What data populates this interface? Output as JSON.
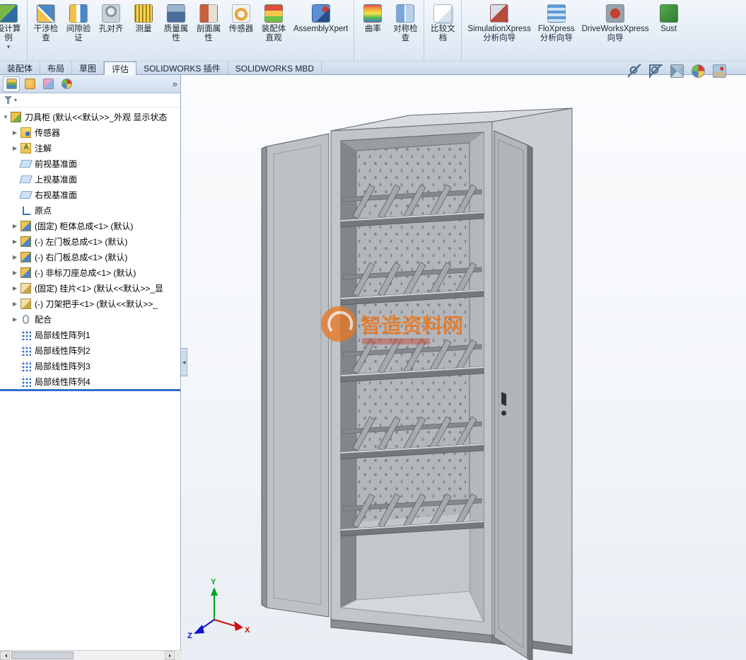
{
  "ribbon": {
    "groups": [
      {
        "items": [
          {
            "label": "设计算\n例",
            "icon": "design-study",
            "has_arrow": true
          }
        ]
      },
      {
        "items": [
          {
            "label": "干涉检\n查",
            "icon": "interference-detection"
          },
          {
            "label": "间隙验\n证",
            "icon": "clearance-verification"
          },
          {
            "label": "孔对齐",
            "icon": "hole-alignment"
          },
          {
            "label": "测量",
            "icon": "measure"
          },
          {
            "label": "质量属\n性",
            "icon": "mass-properties"
          },
          {
            "label": "剖面属\n性",
            "icon": "section-properties"
          },
          {
            "label": "传感器",
            "icon": "sensor"
          },
          {
            "label": "装配体\n直观",
            "icon": "assembly-visualization"
          },
          {
            "label": "AssemblyXpert",
            "icon": "assembly-xpert"
          }
        ]
      },
      {
        "items": [
          {
            "label": "曲率",
            "icon": "curvature"
          },
          {
            "label": "对称检\n查",
            "icon": "symmetry-check"
          }
        ]
      },
      {
        "items": [
          {
            "label": "比较文\n档",
            "icon": "compare-documents"
          }
        ]
      },
      {
        "items": [
          {
            "label": "SimulationXpress\n分析向导",
            "icon": "simulationxpress"
          },
          {
            "label": "FloXpress\n分析向导",
            "icon": "floxpress"
          },
          {
            "label": "DriveWorksXpress\n向导",
            "icon": "driveworksxpress"
          },
          {
            "label": "Sust",
            "icon": "sustainability"
          }
        ]
      }
    ]
  },
  "tabs": {
    "items": [
      {
        "name": "assembly",
        "label": "装配体"
      },
      {
        "name": "layout",
        "label": "布局"
      },
      {
        "name": "sketch",
        "label": "草图"
      },
      {
        "name": "evaluate",
        "label": "评估",
        "active": true
      },
      {
        "name": "solidworks-addins",
        "label": "SOLIDWORKS 插件"
      },
      {
        "name": "solidworks-mbd",
        "label": "SOLIDWORKS MBD"
      }
    ]
  },
  "panel": {
    "overflow_label": "»",
    "tabs": [
      {
        "name": "featuremanager"
      },
      {
        "name": "propertymanager"
      },
      {
        "name": "configurationmanager"
      },
      {
        "name": "displaymanager"
      }
    ]
  },
  "feature_tree": {
    "items": [
      {
        "label": "刀具柜 (默认<<默认>>_外观 显示状态",
        "icon": "assembly",
        "expanded": true
      },
      {
        "label": "传感器",
        "icon": "sensors-folder",
        "collapsed": true
      },
      {
        "label": "注解",
        "icon": "annotations-folder",
        "collapsed": true
      },
      {
        "label": "前视基准面",
        "icon": "plane"
      },
      {
        "label": "上视基准面",
        "icon": "plane"
      },
      {
        "label": "右视基准面",
        "icon": "plane"
      },
      {
        "label": "原点",
        "icon": "origin"
      },
      {
        "label": "(固定) 柜体总成<1> (默认)",
        "icon": "subassembly",
        "collapsed": true
      },
      {
        "label": "(-) 左门板总成<1> (默认)",
        "icon": "subassembly",
        "collapsed": true
      },
      {
        "label": "(-) 右门板总成<1> (默认)",
        "icon": "subassembly",
        "collapsed": true
      },
      {
        "label": "(-) 非标刀座总成<1> (默认)",
        "icon": "subassembly",
        "collapsed": true
      },
      {
        "label": "(固定) 挂片<1> (默认<<默认>>_显",
        "icon": "part",
        "collapsed": true
      },
      {
        "label": "(-) 刀架把手<1> (默认<<默认>>_",
        "icon": "part",
        "collapsed": true
      },
      {
        "label": "配合",
        "icon": "mates-folder",
        "collapsed": true
      },
      {
        "label": "局部线性阵列1",
        "icon": "linear-pattern"
      },
      {
        "label": "局部线性阵列2",
        "icon": "linear-pattern"
      },
      {
        "label": "局部线性阵列3",
        "icon": "linear-pattern"
      },
      {
        "label": "局部线性阵列4",
        "icon": "linear-pattern"
      }
    ]
  },
  "viewport": {
    "heads_up": {
      "icons": [
        {
          "name": "zoom-fit"
        },
        {
          "name": "zoom-area"
        },
        {
          "name": "view-orientation"
        },
        {
          "name": "edit-appearance"
        },
        {
          "name": "apply-scene"
        }
      ]
    },
    "watermark": {
      "text": "智造资料网"
    },
    "triad": {
      "x_label": "X",
      "y_label": "Y",
      "z_label": "Z"
    }
  },
  "colors": {
    "watermark_orange": "#e87720",
    "watermark_red": "#c43b2a",
    "rollback_blue": "#2f6fd0",
    "triad_x": "#cc1111",
    "triad_y": "#00a020",
    "triad_z": "#1111cc",
    "cabinet_gray": "#c2c6ca",
    "selection_blue": "#3a7bd5"
  }
}
